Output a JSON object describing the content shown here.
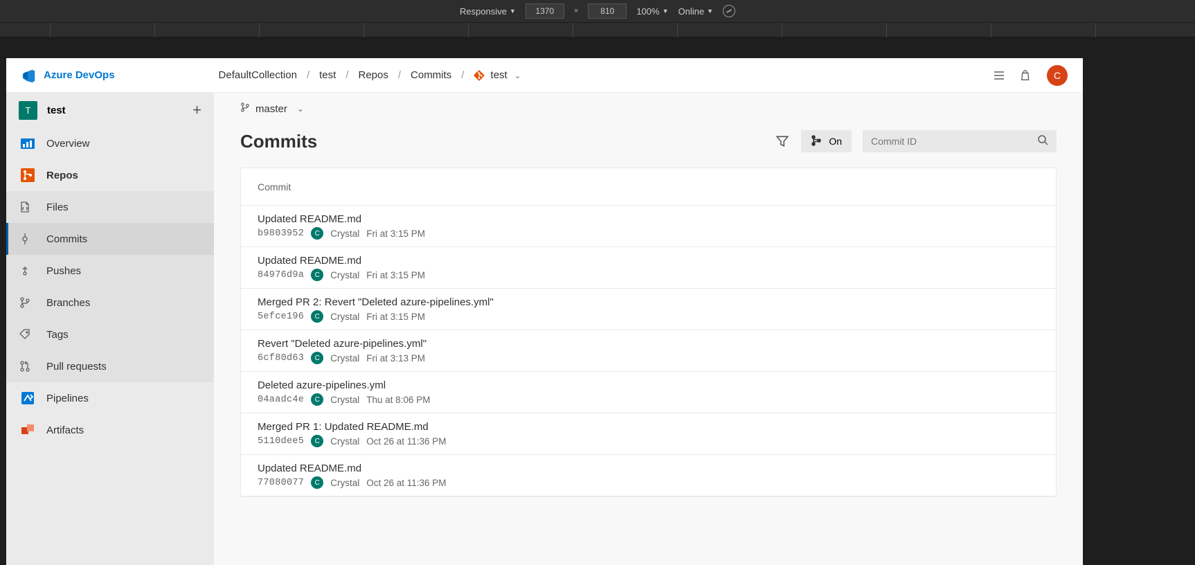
{
  "devtools": {
    "device_label": "Responsive",
    "width": "1370",
    "height": "810",
    "zoom": "100%",
    "throttle": "Online"
  },
  "header": {
    "product": "Azure DevOps",
    "breadcrumbs": {
      "collection": "DefaultCollection",
      "project": "test",
      "area": "Repos",
      "page": "Commits",
      "repo": "test"
    },
    "avatar_initial": "C"
  },
  "sidebar": {
    "project_initial": "T",
    "project_name": "test",
    "overview": "Overview",
    "repos": "Repos",
    "sub": {
      "files": "Files",
      "commits": "Commits",
      "pushes": "Pushes",
      "branches": "Branches",
      "tags": "Tags",
      "pull_requests": "Pull requests"
    },
    "pipelines": "Pipelines",
    "artifacts": "Artifacts"
  },
  "content": {
    "branch": "master",
    "title": "Commits",
    "graph_toggle": "On",
    "search_placeholder": "Commit ID",
    "column_header": "Commit"
  },
  "commits": [
    {
      "msg": "Updated README.md",
      "hash": "b9803952",
      "author_initial": "C",
      "author": "Crystal",
      "date": "Fri at 3:15 PM"
    },
    {
      "msg": "Updated README.md",
      "hash": "84976d9a",
      "author_initial": "C",
      "author": "Crystal",
      "date": "Fri at 3:15 PM"
    },
    {
      "msg": "Merged PR 2: Revert \"Deleted azure-pipelines.yml\"",
      "hash": "5efce196",
      "author_initial": "C",
      "author": "Crystal",
      "date": "Fri at 3:15 PM"
    },
    {
      "msg": "Revert \"Deleted azure-pipelines.yml\"",
      "hash": "6cf80d63",
      "author_initial": "C",
      "author": "Crystal",
      "date": "Fri at 3:13 PM"
    },
    {
      "msg": "Deleted azure-pipelines.yml",
      "hash": "04aadc4e",
      "author_initial": "C",
      "author": "Crystal",
      "date": "Thu at 8:06 PM"
    },
    {
      "msg": "Merged PR 1: Updated README.md",
      "hash": "5110dee5",
      "author_initial": "C",
      "author": "Crystal",
      "date": "Oct 26 at 11:36 PM"
    },
    {
      "msg": "Updated README.md",
      "hash": "77080077",
      "author_initial": "C",
      "author": "Crystal",
      "date": "Oct 26 at 11:36 PM"
    }
  ]
}
